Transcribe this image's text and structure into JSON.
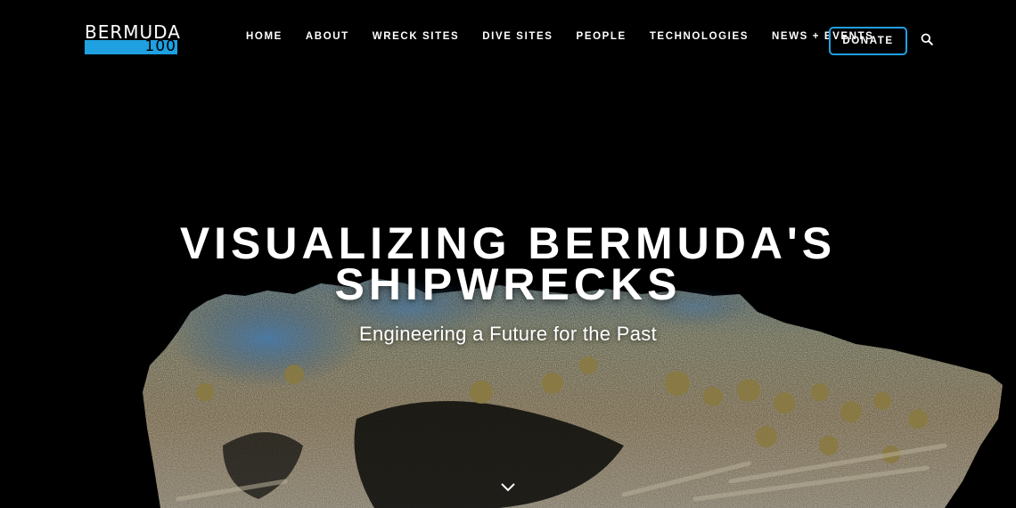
{
  "brand": {
    "word": "BERMUDA",
    "number": "100",
    "accent_color": "#1fa0e0",
    "logo_icon": "bermuda100-logo"
  },
  "nav": {
    "items": [
      {
        "label": "HOME"
      },
      {
        "label": "ABOUT"
      },
      {
        "label": "WRECK SITES"
      },
      {
        "label": "DIVE SITES"
      },
      {
        "label": "PEOPLE"
      },
      {
        "label": "TECHNOLOGIES"
      },
      {
        "label": "NEWS + EVENTS"
      }
    ],
    "donate_label": "DONATE",
    "search_icon": "search-icon"
  },
  "hero": {
    "title_line1": "VISUALIZING BERMUDA'S",
    "title_line2": "SHIPWRECKS",
    "subtitle": "Engineering a Future for the Past",
    "background": "underwater shipwreck point-cloud scan",
    "scroll_icon": "chevron-down-icon"
  },
  "colors": {
    "background": "#000000",
    "text": "#ffffff",
    "accent": "#1fa0e0"
  }
}
